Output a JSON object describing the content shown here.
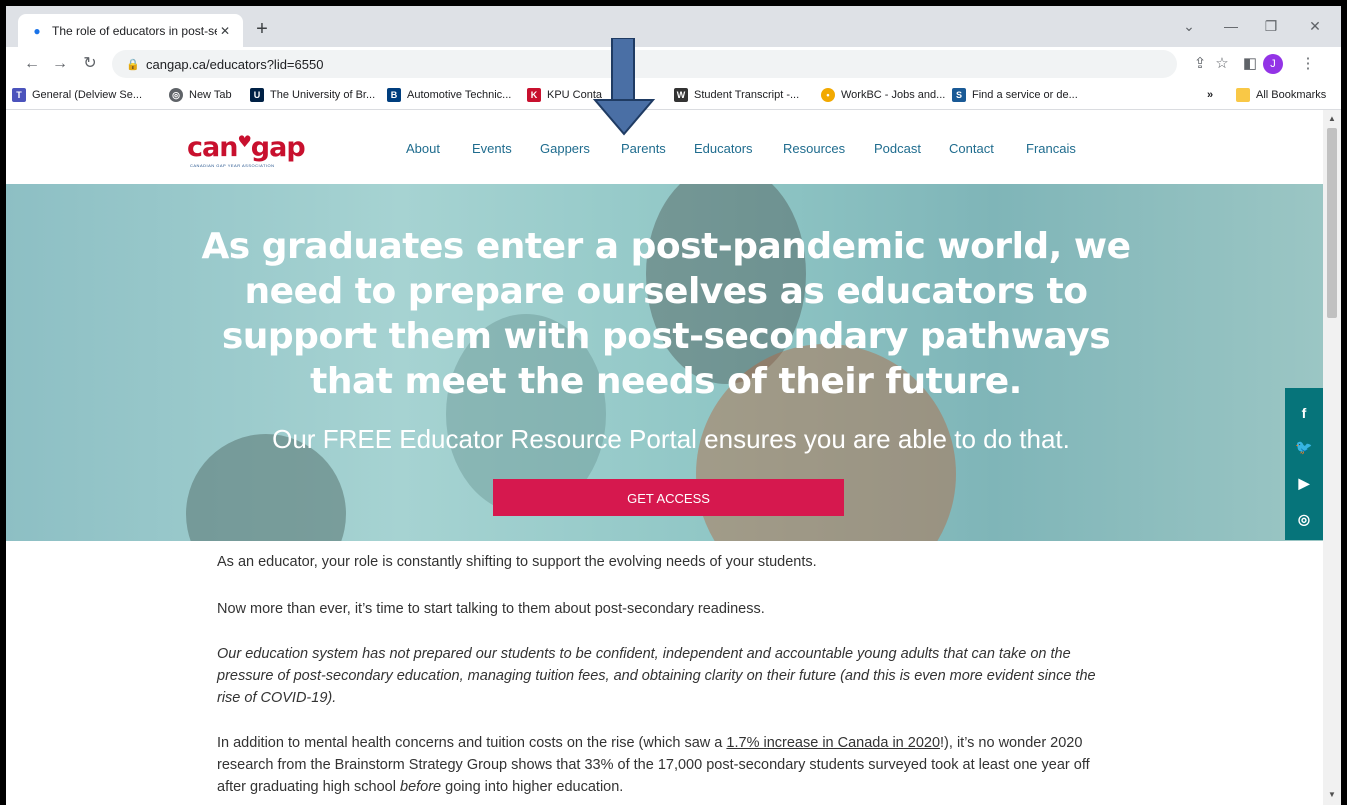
{
  "browser": {
    "tab_title": "The role of educators in post-se",
    "url": "cangap.ca/educators?lid=6550",
    "avatar_letter": "J",
    "bookmarks": [
      "General (Delview Se...",
      "New Tab",
      "The University of Br...",
      "Automotive Technic...",
      "KPU Conta",
      "Student Transcript -...",
      "WorkBC - Jobs and...",
      "Find a service or de..."
    ],
    "bookmarks_overflow": "»",
    "all_bookmarks": "All Bookmarks"
  },
  "site": {
    "logo": "can gap",
    "logo_sub": "CANADIAN GAP YEAR ASSOCIATION",
    "nav": [
      "About",
      "Events",
      "Gappers",
      "Parents",
      "Educators",
      "Resources",
      "Podcast",
      "Contact",
      "Francais"
    ],
    "hero_title": "As graduates enter a post-pandemic world, we need to prepare ourselves as educators to support them with post-secondary pathways that meet the needs of their future.",
    "hero_sub": "Our FREE Educator Resource Portal ensures you are able to do that.",
    "cta": "GET ACCESS",
    "social": [
      "f",
      "twitter",
      "youtube",
      "instagram"
    ]
  },
  "content": {
    "p1": "As an educator, your role is constantly shifting to support the evolving needs of your students.",
    "p2": "Now more than ever, it’s time to start talking to them about post-secondary readiness.",
    "p3": "Our education system has not prepared our students to be confident, independent and accountable young adults that can take on the pressure of post-secondary education, managing tuition fees, and obtaining clarity on their future (and this is even more evident since the rise of COVID-19).",
    "p4_a": "In addition to mental health concerns and tuition costs on the rise (which saw a ",
    "p4_link": "1.7% increase in Canada in 2020",
    "p4_b": "!), it’s no wonder 2020 research from the Brainstorm Strategy Group shows that 33% of the 17,000 post-secondary students surveyed took at least one year off after graduating high school ",
    "p4_em": "before",
    "p4_c": " going into higher education."
  },
  "colors": {
    "accent_red": "#d6184e",
    "nav_teal": "#1f6c8e",
    "social_teal": "#06747a",
    "annotation_arrow": "#4a6fa5"
  }
}
